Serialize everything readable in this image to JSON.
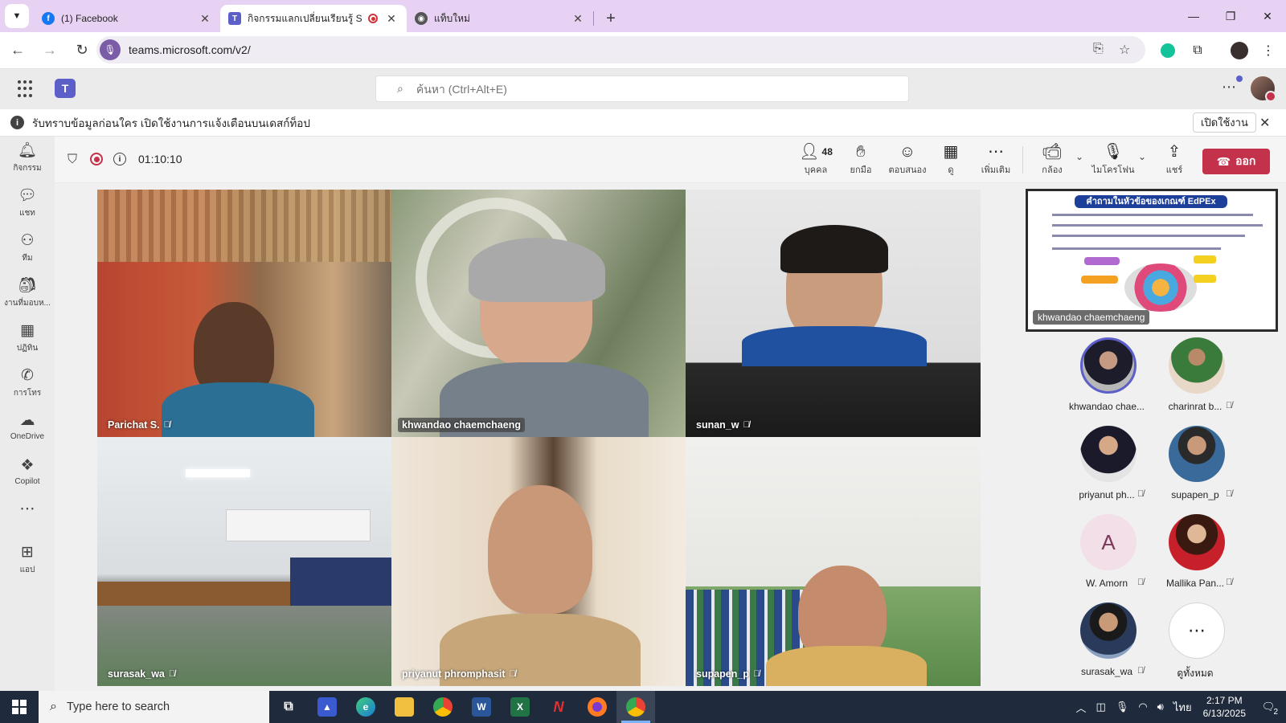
{
  "browser": {
    "tabs": [
      {
        "title": "(1) Facebook",
        "icon": "facebook-icon"
      },
      {
        "title": "กิจกรรมแลกเปลี่ยนเรียนรู้ SAR",
        "icon": "teams-icon",
        "active": true,
        "recording": true
      },
      {
        "title": "แท็บใหม่",
        "icon": "chrome-icon"
      }
    ],
    "url": "teams.microsoft.com/v2/"
  },
  "teams": {
    "search_placeholder": "ค้นหา (Ctrl+Alt+E)",
    "banner_message": "รับทราบข้อมูลก่อนใคร เปิดใช้งานการแจ้งเตือนบนเดสก์ท็อป",
    "banner_button": "เปิดใช้งาน",
    "rail": [
      {
        "label": "กิจกรรม",
        "icon": "bell-icon"
      },
      {
        "label": "แชท",
        "icon": "chat-icon"
      },
      {
        "label": "ทีม",
        "icon": "teams-people-icon"
      },
      {
        "label": "งานที่มอบห...",
        "icon": "assignments-icon"
      },
      {
        "label": "ปฏิทิน",
        "icon": "calendar-icon"
      },
      {
        "label": "การโทร",
        "icon": "phone-icon"
      },
      {
        "label": "OneDrive",
        "icon": "cloud-icon"
      },
      {
        "label": "Copilot",
        "icon": "copilot-icon"
      },
      {
        "label": "แอป",
        "icon": "add-app-icon"
      }
    ]
  },
  "meeting": {
    "timer": "01:10:10",
    "participants_count": "48",
    "controls": {
      "people": "บุคคล",
      "raise": "ยกมือ",
      "react": "ตอบสนอง",
      "view": "ดู",
      "more": "เพิ่มเติม",
      "camera": "กล้อง",
      "mic": "ไมโครโฟน",
      "share": "แชร์",
      "leave": "ออก"
    },
    "tiles": [
      {
        "name": "Parichat S."
      },
      {
        "name": "khwandao chaemchaeng",
        "speaking": true
      },
      {
        "name": "sunan_w"
      },
      {
        "name": "surasak_wa"
      },
      {
        "name": "priyanut phromphasit"
      },
      {
        "name": "supapen_p"
      }
    ],
    "shared_screen": {
      "title": "คำถามในหัวข้อของเกณฑ์ EdPEx",
      "presenter": "khwandao chaemchaeng"
    },
    "roster": [
      {
        "name": "khwandao chae...",
        "muted": false
      },
      {
        "name": "charinrat b...",
        "muted": true
      },
      {
        "name": "priyanut ph...",
        "muted": true
      },
      {
        "name": "supapen_p",
        "muted": true
      },
      {
        "name": "W. Amorn",
        "muted": true,
        "initial": "A"
      },
      {
        "name": "Mallika Pan...",
        "muted": true
      },
      {
        "name": "surasak_wa",
        "muted": true
      },
      {
        "name": "ดูทั้งหมด",
        "muted": false
      }
    ]
  },
  "taskbar": {
    "search_placeholder": "Type here to search",
    "time": "2:17 PM",
    "date": "6/13/2025",
    "language": "ไทย",
    "notifications": "2"
  },
  "colors": {
    "tabstrip": "#e8d2f3",
    "leave_red": "#c4314b",
    "teams_purple": "#5b5fc7",
    "taskbar": "#1f2b3c"
  }
}
